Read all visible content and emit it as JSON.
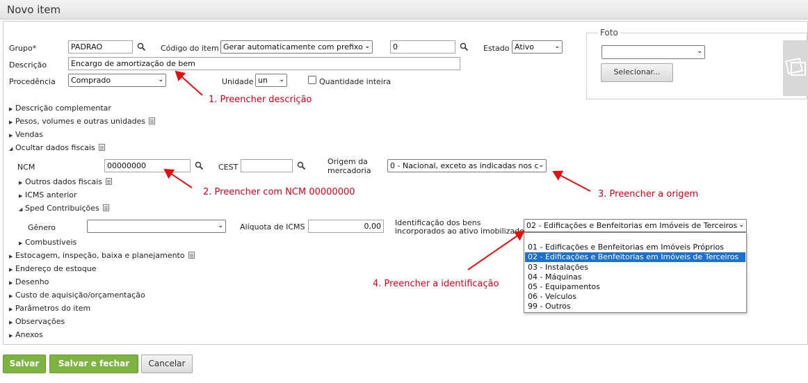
{
  "window": {
    "title": "Novo item"
  },
  "form": {
    "grupo": {
      "label": "Grupo*",
      "value": "PADRAO"
    },
    "codigo": {
      "label": "Código do item",
      "select_value": "Gerar automaticamente com prefixo",
      "value": "0"
    },
    "estado": {
      "label": "Estado",
      "value": "Ativo"
    },
    "descricao": {
      "label": "Descrição",
      "value": "Encargo de amortização de bem"
    },
    "procedencia": {
      "label": "Procedência",
      "value": "Comprado"
    },
    "unidade": {
      "label": "Unidade",
      "value": "un"
    },
    "quantidade_inteira": {
      "label": "Quantidade inteira"
    }
  },
  "foto": {
    "legend": "Foto",
    "select_value": "",
    "button": "Selecionar..."
  },
  "sections": {
    "descricao_complementar": "Descrição complementar",
    "pesos": "Pesos, volumes e outras unidades",
    "vendas": "Vendas",
    "ocultar_fiscais": "Ocultar dados fiscais",
    "outros_fiscais": "Outros dados fiscais",
    "icms_anterior": "ICMS anterior",
    "sped": "Sped Contribuições",
    "combustiveis": "Combustíveis",
    "estocagem": "Estocagem, inspeção, baixa e planejamento",
    "endereco": "Endereço de estoque",
    "desenho": "Desenho",
    "custo": "Custo de aquisição/orçamentação",
    "parametros": "Parâmetros do item",
    "observacoes": "Observações",
    "anexos": "Anexos"
  },
  "fiscal": {
    "ncm": {
      "label": "NCM",
      "value": "00000000"
    },
    "cest": {
      "label": "CEST",
      "value": ""
    },
    "origem": {
      "label_line1": "Origem da",
      "label_line2": "mercadoria",
      "value": "0 - Nacional, exceto as indicadas nos c"
    },
    "genero": {
      "label": "Gênero",
      "value": ""
    },
    "aliquota": {
      "label": "Alíquota de ICMS",
      "value": "0,00"
    },
    "identificacao": {
      "label_line1": "Identificação dos bens",
      "label_line2": "incorporados ao ativo imobilizado",
      "value": "02 - Edificações e Benfeitorias em Imóveis de Terceiros",
      "options": [
        "",
        "01 - Edificações e Benfeitorias em Imóveis Próprios",
        "02 - Edificações e Benfeitorias em Imóveis de Terceiros",
        "03 - Instalações",
        "04 - Máquinas",
        "05 - Equipamentos",
        "06 - Veículos",
        "99 - Outros"
      ],
      "selected_index": 2
    }
  },
  "annotations": {
    "a1": "1. Preencher descrição",
    "a2": "2. Preencher com NCM 00000000",
    "a3": "3. Preencher a origem",
    "a4": "4. Preencher a identificação"
  },
  "buttons": {
    "save": "Salvar",
    "save_close": "Salvar e fechar",
    "cancel": "Cancelar"
  },
  "colors": {
    "accent_green": "#7cb342",
    "annotation_red": "#d0021b",
    "selected_blue": "#1e6fd0"
  }
}
